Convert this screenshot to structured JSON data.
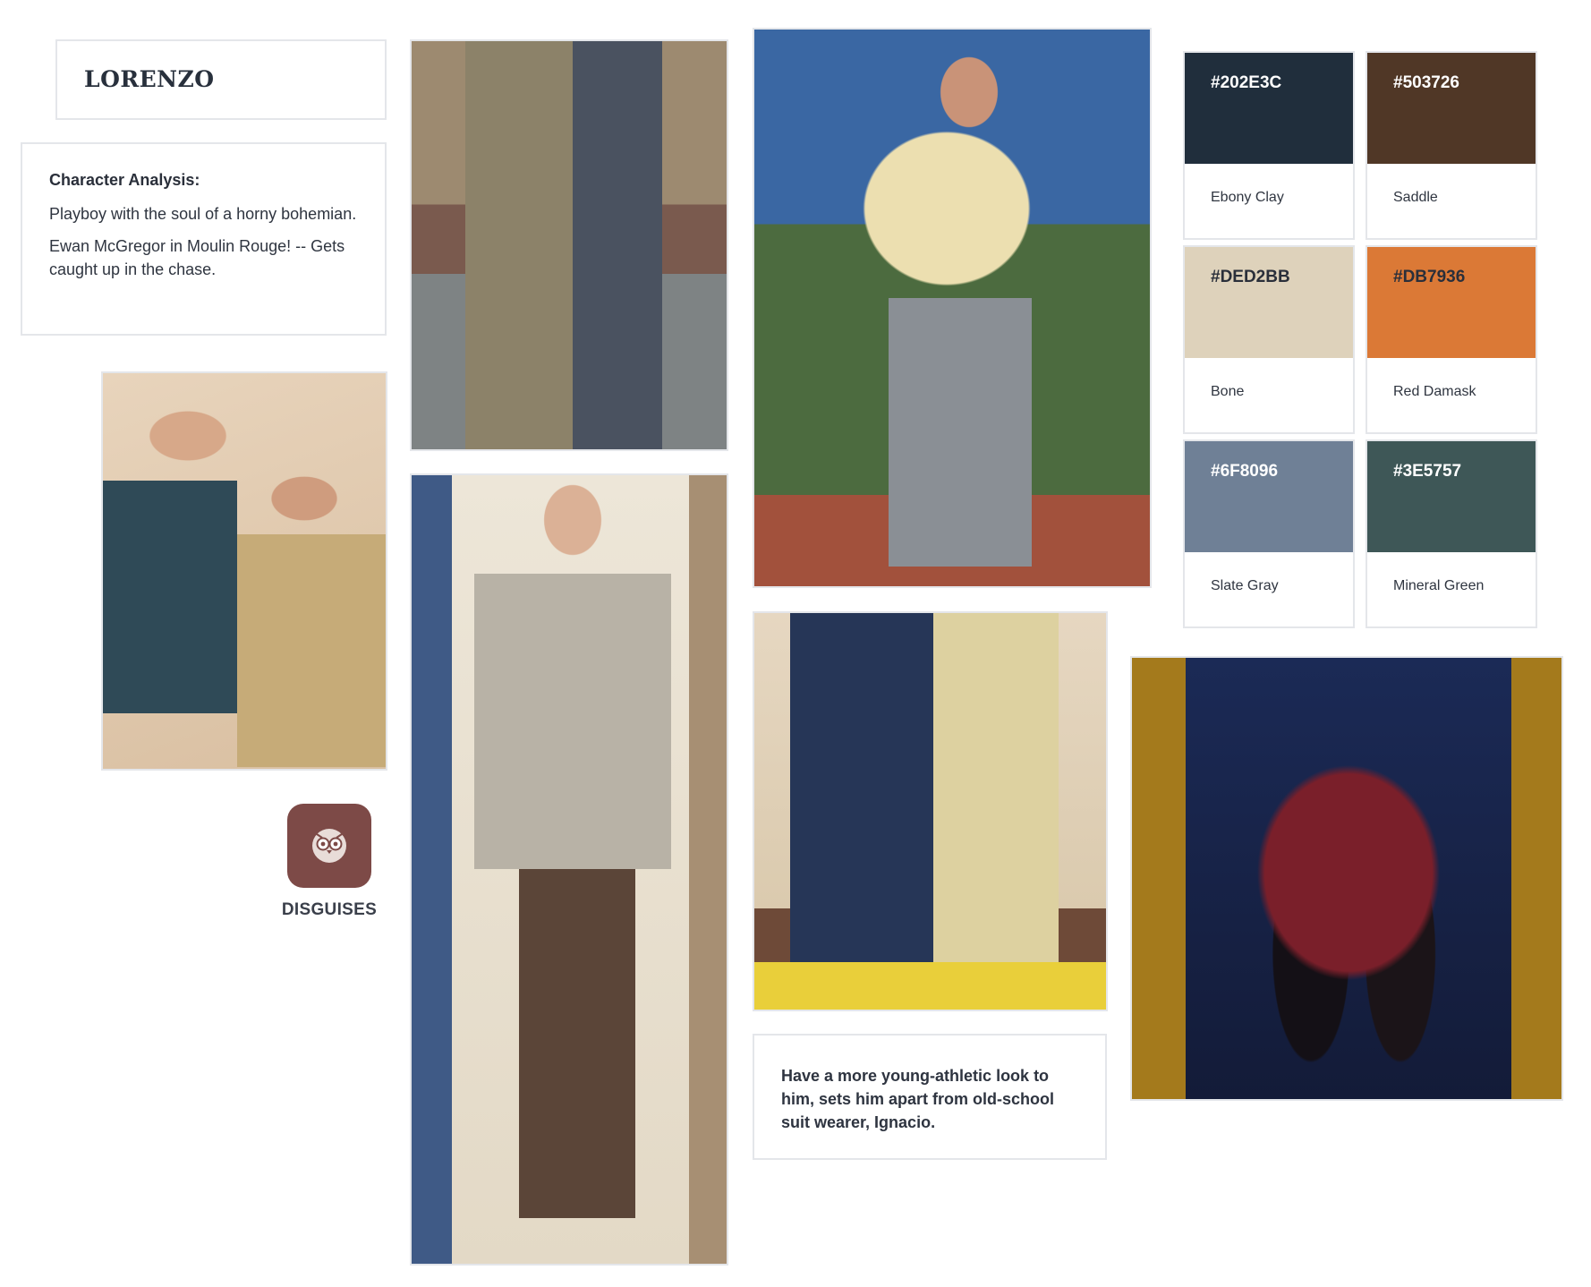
{
  "board": {
    "title": "LORENZO",
    "analysis": {
      "heading": "Character Analysis:",
      "paragraphs": [
        "Playboy with the soul of a horny bohemian.",
        "Ewan McGregor in Moulin Rouge! -- Gets caught up in the chase."
      ]
    },
    "note": "Have a more young-athletic look to him, sets him apart from old-school suit wearer, Ignacio.",
    "disguises": {
      "label": "DISGUISES",
      "icon": "owl-icon",
      "icon_color": "#7D4A47"
    },
    "palette": [
      {
        "hex": "#202E3C",
        "name": "Ebony Clay",
        "text_color": "#ffffff"
      },
      {
        "hex": "#503726",
        "name": "Saddle",
        "text_color": "#ffffff"
      },
      {
        "hex": "#DED2BB",
        "name": "Bone",
        "text_color": "#2a2f3a"
      },
      {
        "hex": "#DB7936",
        "name": "Red Damask",
        "text_color": "#2a2f3a"
      },
      {
        "hex": "#6F8096",
        "name": "Slate Gray",
        "text_color": "#ffffff"
      },
      {
        "hex": "#3E5757",
        "name": "Mineral Green",
        "text_color": "#ffffff"
      }
    ]
  }
}
